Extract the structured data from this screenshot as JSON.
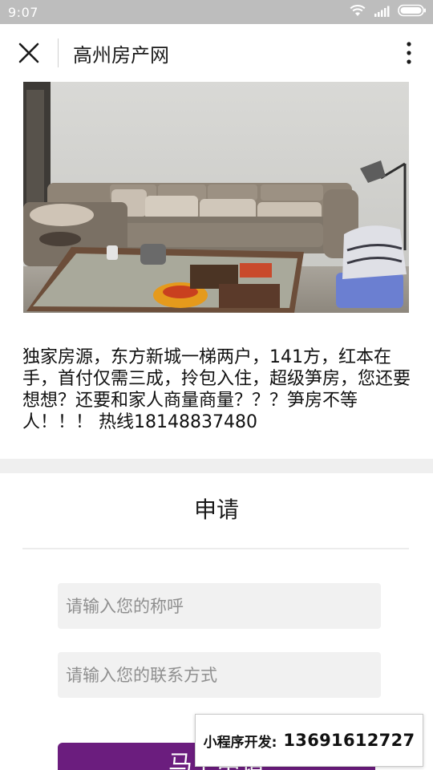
{
  "status_bar": {
    "time": "9:07",
    "icons": [
      "wifi-icon",
      "signal-icon",
      "battery-icon"
    ]
  },
  "nav": {
    "title": "高州房产网",
    "close_icon": "close-icon",
    "more_icon": "more-vertical-icon"
  },
  "listing": {
    "photo": "living-room-photo",
    "description": "独家房源，东方新城一梯两户，141方，红本在手，首付仅需三成，拎包入住，超级笋房，您还要想想？还要和家人商量商量？？？笋房不等人！！！ 热线18148837480"
  },
  "form": {
    "title": "申请",
    "name_placeholder": "请输入您的称呼",
    "contact_placeholder": "请输入您的联系方式",
    "submit_label": "马上申请"
  },
  "promo": {
    "label": "小程序开发:",
    "phone": "13691612727"
  },
  "colors": {
    "status_bar": "#bdbdbd",
    "accent": "#6b1d7e",
    "field_bg": "#f1f1f1",
    "band": "#efefef"
  }
}
